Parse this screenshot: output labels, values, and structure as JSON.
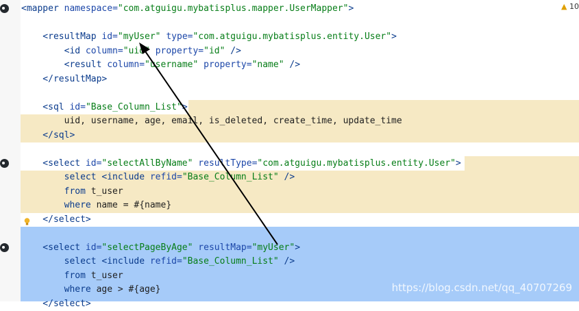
{
  "warnings": {
    "icon": "warning-triangle-icon",
    "count": "10"
  },
  "watermark": "https://blog.csdn.net/qq_40707269",
  "colors": {
    "yellow_highlight": "#f6e9c4",
    "blue_selection": "#a6cbf9"
  },
  "lines": [
    {
      "tokens": [
        [
          "tag",
          "<mapper "
        ],
        [
          "attr",
          "namespace="
        ],
        [
          "str",
          "\"com.atguigu.mybatisplus.mapper.UserMapper\""
        ],
        [
          "tag",
          ">"
        ]
      ]
    },
    {
      "tokens": []
    },
    {
      "tokens": [
        [
          "tag",
          "    <resultMap "
        ],
        [
          "attr",
          "id="
        ],
        [
          "str",
          "\"myUser\" "
        ],
        [
          "attr",
          "type="
        ],
        [
          "str",
          "\"com.atguigu.mybatisplus.entity.User\""
        ],
        [
          "tag",
          ">"
        ]
      ]
    },
    {
      "tokens": [
        [
          "tag",
          "        <id "
        ],
        [
          "attr",
          "column="
        ],
        [
          "str",
          "\"uid\" "
        ],
        [
          "attr",
          "property="
        ],
        [
          "str",
          "\"id\" "
        ],
        [
          "tag",
          "/>"
        ]
      ]
    },
    {
      "tokens": [
        [
          "tag",
          "        <result "
        ],
        [
          "attr",
          "column="
        ],
        [
          "str",
          "\"username\" "
        ],
        [
          "attr",
          "property="
        ],
        [
          "str",
          "\"name\" "
        ],
        [
          "tag",
          "/>"
        ]
      ]
    },
    {
      "tokens": [
        [
          "tag",
          "    </resultMap>"
        ]
      ]
    },
    {
      "tokens": []
    },
    {
      "tokens": [
        [
          "tag",
          "    <sql "
        ],
        [
          "attr",
          "id="
        ],
        [
          "str",
          "\"Base_Column_List\""
        ],
        [
          "tag",
          ">"
        ]
      ]
    },
    {
      "tokens": [
        [
          "plain",
          "        uid, username, age, email, is_deleted, create_time, update_time"
        ]
      ]
    },
    {
      "tokens": [
        [
          "tag",
          "    </sql>"
        ]
      ]
    },
    {
      "tokens": []
    },
    {
      "tokens": [
        [
          "tag",
          "    <select "
        ],
        [
          "attr",
          "id="
        ],
        [
          "str",
          "\"selectAllByName\" "
        ],
        [
          "attr",
          "resultType="
        ],
        [
          "str",
          "\"com.atguigu.mybatisplus.entity.User\""
        ],
        [
          "tag",
          ">"
        ]
      ]
    },
    {
      "tokens": [
        [
          "kw",
          "        select "
        ],
        [
          "tag",
          "<include "
        ],
        [
          "attr",
          "refid="
        ],
        [
          "str",
          "\"Base_Column_List\" "
        ],
        [
          "tag",
          "/>"
        ]
      ]
    },
    {
      "tokens": [
        [
          "kw",
          "        from "
        ],
        [
          "plain",
          "t_user"
        ]
      ]
    },
    {
      "tokens": [
        [
          "kw",
          "        where "
        ],
        [
          "plain",
          "name = #{name}"
        ]
      ]
    },
    {
      "tokens": [
        [
          "tag",
          "    </select>"
        ]
      ]
    },
    {
      "tokens": []
    },
    {
      "tokens": [
        [
          "tag",
          "    <select "
        ],
        [
          "attr",
          "id="
        ],
        [
          "str",
          "\"selectPageByAge\" "
        ],
        [
          "attr",
          "resultMap="
        ],
        [
          "str",
          "\"myUser\""
        ],
        [
          "tag",
          ">"
        ]
      ]
    },
    {
      "tokens": [
        [
          "kw",
          "        select "
        ],
        [
          "tag",
          "<include "
        ],
        [
          "attr",
          "refid="
        ],
        [
          "str",
          "\"Base_Column_List\" "
        ],
        [
          "tag",
          "/>"
        ]
      ]
    },
    {
      "tokens": [
        [
          "kw",
          "        from "
        ],
        [
          "plain",
          "t_user"
        ]
      ]
    },
    {
      "tokens": [
        [
          "kw",
          "        where "
        ],
        [
          "plain",
          "age > #{age}"
        ]
      ]
    },
    {
      "tokens": [
        [
          "tag",
          "    </select>"
        ]
      ]
    }
  ]
}
